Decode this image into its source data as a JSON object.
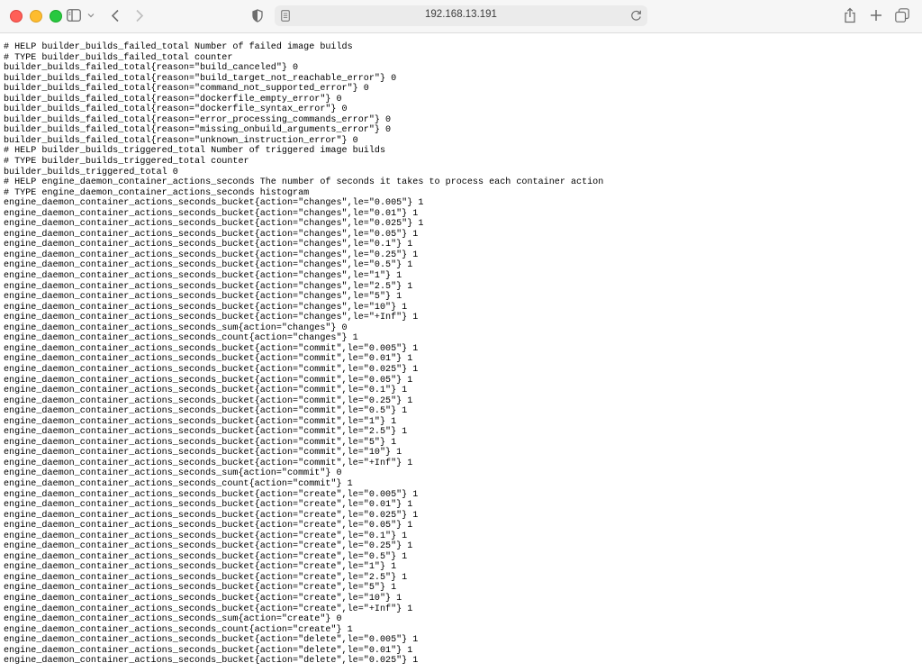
{
  "browser": {
    "url": "192.168.13.191"
  },
  "metrics_lines": [
    "# HELP builder_builds_failed_total Number of failed image builds",
    "# TYPE builder_builds_failed_total counter",
    "builder_builds_failed_total{reason=\"build_canceled\"} 0",
    "builder_builds_failed_total{reason=\"build_target_not_reachable_error\"} 0",
    "builder_builds_failed_total{reason=\"command_not_supported_error\"} 0",
    "builder_builds_failed_total{reason=\"dockerfile_empty_error\"} 0",
    "builder_builds_failed_total{reason=\"dockerfile_syntax_error\"} 0",
    "builder_builds_failed_total{reason=\"error_processing_commands_error\"} 0",
    "builder_builds_failed_total{reason=\"missing_onbuild_arguments_error\"} 0",
    "builder_builds_failed_total{reason=\"unknown_instruction_error\"} 0",
    "# HELP builder_builds_triggered_total Number of triggered image builds",
    "# TYPE builder_builds_triggered_total counter",
    "builder_builds_triggered_total 0",
    "# HELP engine_daemon_container_actions_seconds The number of seconds it takes to process each container action",
    "# TYPE engine_daemon_container_actions_seconds histogram",
    "engine_daemon_container_actions_seconds_bucket{action=\"changes\",le=\"0.005\"} 1",
    "engine_daemon_container_actions_seconds_bucket{action=\"changes\",le=\"0.01\"} 1",
    "engine_daemon_container_actions_seconds_bucket{action=\"changes\",le=\"0.025\"} 1",
    "engine_daemon_container_actions_seconds_bucket{action=\"changes\",le=\"0.05\"} 1",
    "engine_daemon_container_actions_seconds_bucket{action=\"changes\",le=\"0.1\"} 1",
    "engine_daemon_container_actions_seconds_bucket{action=\"changes\",le=\"0.25\"} 1",
    "engine_daemon_container_actions_seconds_bucket{action=\"changes\",le=\"0.5\"} 1",
    "engine_daemon_container_actions_seconds_bucket{action=\"changes\",le=\"1\"} 1",
    "engine_daemon_container_actions_seconds_bucket{action=\"changes\",le=\"2.5\"} 1",
    "engine_daemon_container_actions_seconds_bucket{action=\"changes\",le=\"5\"} 1",
    "engine_daemon_container_actions_seconds_bucket{action=\"changes\",le=\"10\"} 1",
    "engine_daemon_container_actions_seconds_bucket{action=\"changes\",le=\"+Inf\"} 1",
    "engine_daemon_container_actions_seconds_sum{action=\"changes\"} 0",
    "engine_daemon_container_actions_seconds_count{action=\"changes\"} 1",
    "engine_daemon_container_actions_seconds_bucket{action=\"commit\",le=\"0.005\"} 1",
    "engine_daemon_container_actions_seconds_bucket{action=\"commit\",le=\"0.01\"} 1",
    "engine_daemon_container_actions_seconds_bucket{action=\"commit\",le=\"0.025\"} 1",
    "engine_daemon_container_actions_seconds_bucket{action=\"commit\",le=\"0.05\"} 1",
    "engine_daemon_container_actions_seconds_bucket{action=\"commit\",le=\"0.1\"} 1",
    "engine_daemon_container_actions_seconds_bucket{action=\"commit\",le=\"0.25\"} 1",
    "engine_daemon_container_actions_seconds_bucket{action=\"commit\",le=\"0.5\"} 1",
    "engine_daemon_container_actions_seconds_bucket{action=\"commit\",le=\"1\"} 1",
    "engine_daemon_container_actions_seconds_bucket{action=\"commit\",le=\"2.5\"} 1",
    "engine_daemon_container_actions_seconds_bucket{action=\"commit\",le=\"5\"} 1",
    "engine_daemon_container_actions_seconds_bucket{action=\"commit\",le=\"10\"} 1",
    "engine_daemon_container_actions_seconds_bucket{action=\"commit\",le=\"+Inf\"} 1",
    "engine_daemon_container_actions_seconds_sum{action=\"commit\"} 0",
    "engine_daemon_container_actions_seconds_count{action=\"commit\"} 1",
    "engine_daemon_container_actions_seconds_bucket{action=\"create\",le=\"0.005\"} 1",
    "engine_daemon_container_actions_seconds_bucket{action=\"create\",le=\"0.01\"} 1",
    "engine_daemon_container_actions_seconds_bucket{action=\"create\",le=\"0.025\"} 1",
    "engine_daemon_container_actions_seconds_bucket{action=\"create\",le=\"0.05\"} 1",
    "engine_daemon_container_actions_seconds_bucket{action=\"create\",le=\"0.1\"} 1",
    "engine_daemon_container_actions_seconds_bucket{action=\"create\",le=\"0.25\"} 1",
    "engine_daemon_container_actions_seconds_bucket{action=\"create\",le=\"0.5\"} 1",
    "engine_daemon_container_actions_seconds_bucket{action=\"create\",le=\"1\"} 1",
    "engine_daemon_container_actions_seconds_bucket{action=\"create\",le=\"2.5\"} 1",
    "engine_daemon_container_actions_seconds_bucket{action=\"create\",le=\"5\"} 1",
    "engine_daemon_container_actions_seconds_bucket{action=\"create\",le=\"10\"} 1",
    "engine_daemon_container_actions_seconds_bucket{action=\"create\",le=\"+Inf\"} 1",
    "engine_daemon_container_actions_seconds_sum{action=\"create\"} 0",
    "engine_daemon_container_actions_seconds_count{action=\"create\"} 1",
    "engine_daemon_container_actions_seconds_bucket{action=\"delete\",le=\"0.005\"} 1",
    "engine_daemon_container_actions_seconds_bucket{action=\"delete\",le=\"0.01\"} 1",
    "engine_daemon_container_actions_seconds_bucket{action=\"delete\",le=\"0.025\"} 1"
  ]
}
